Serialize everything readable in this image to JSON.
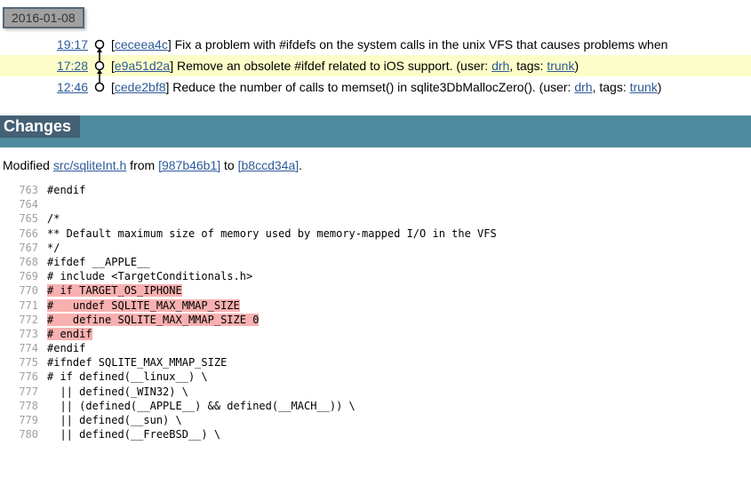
{
  "date": "2016-01-08",
  "timeline": [
    {
      "time": "19:17",
      "hash": "ceceea4c",
      "msg_prefix": " Fix a problem with #ifdefs on the system calls in the unix VFS that causes problems when",
      "highlighted": false
    },
    {
      "time": "17:28",
      "hash": "e9a51d2a",
      "msg_prefix": " Remove an obsolete #ifdef related to iOS support. (user: ",
      "user": "drh",
      "msg_mid": ", tags: ",
      "tag": "trunk",
      "msg_end": ")",
      "highlighted": true
    },
    {
      "time": "12:46",
      "hash": "cede2bf8",
      "msg_prefix": " Reduce the number of calls to memset() in sqlite3DbMallocZero(). (user: ",
      "user": "drh",
      "msg_mid": ", tags: ",
      "tag": "trunk",
      "msg_end": ")",
      "highlighted": false
    }
  ],
  "changes_title": "Changes",
  "modified": {
    "prefix": "Modified ",
    "file": "src/sqliteInt.h",
    "middle1": " from ",
    "hash1": "[987b46b1]",
    "middle2": " to ",
    "hash2": "[b8ccd34a]",
    "end": "."
  },
  "diff_lines": [
    {
      "n": 763,
      "t": "#endif",
      "del": false
    },
    {
      "n": 764,
      "t": "",
      "del": false
    },
    {
      "n": 765,
      "t": "/*",
      "del": false
    },
    {
      "n": 766,
      "t": "** Default maximum size of memory used by memory-mapped I/O in the VFS",
      "del": false
    },
    {
      "n": 767,
      "t": "*/",
      "del": false
    },
    {
      "n": 768,
      "t": "#ifdef __APPLE__",
      "del": false
    },
    {
      "n": 769,
      "t": "# include <TargetConditionals.h>",
      "del": false
    },
    {
      "n": 770,
      "t": "# if TARGET_OS_IPHONE",
      "del": true
    },
    {
      "n": 771,
      "t": "#   undef SQLITE_MAX_MMAP_SIZE",
      "del": true
    },
    {
      "n": 772,
      "t": "#   define SQLITE_MAX_MMAP_SIZE 0",
      "del": true
    },
    {
      "n": 773,
      "t": "# endif",
      "del": true
    },
    {
      "n": 774,
      "t": "#endif",
      "del": false
    },
    {
      "n": 775,
      "t": "#ifndef SQLITE_MAX_MMAP_SIZE",
      "del": false
    },
    {
      "n": 776,
      "t": "# if defined(__linux__) \\",
      "del": false
    },
    {
      "n": 777,
      "t": "  || defined(_WIN32) \\",
      "del": false
    },
    {
      "n": 778,
      "t": "  || (defined(__APPLE__) && defined(__MACH__)) \\",
      "del": false
    },
    {
      "n": 779,
      "t": "  || defined(__sun) \\",
      "del": false
    },
    {
      "n": 780,
      "t": "  || defined(__FreeBSD__) \\",
      "del": false
    }
  ]
}
